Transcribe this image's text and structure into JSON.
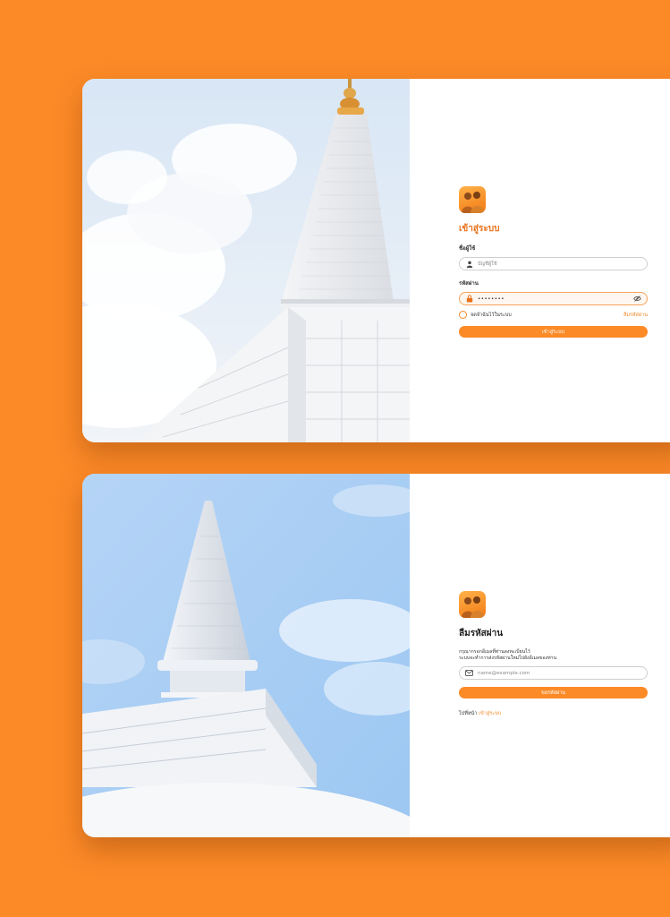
{
  "colors": {
    "background": "#FC8A27",
    "accent": "#FC8A27",
    "link": "#F08A2A"
  },
  "login": {
    "title": "เข้าสู่ระบบ",
    "username_label": "ชื่อผู้ใช้",
    "username_placeholder": "บัญชีผู้ใช้",
    "username_icon": "user-icon",
    "password_label": "รหัสผ่าน",
    "password_value": "••••••••",
    "password_icon": "lock-icon",
    "toggle_icon": "eye-slash-icon",
    "remember_label": "จดจำฉันไว้ในระบบ",
    "forgot_link": "ลืมรหัสผ่าน",
    "submit_label": "เข้าสู่ระบบ"
  },
  "forgot": {
    "title": "ลืมรหัสผ่าน",
    "description_line1": "กรุณากรอกอีเมลที่ท่านลงทะเบียนไว้",
    "description_line2": "ระบบจะทำการส่งรหัสผ่านใหม่ไปยังอีเมลของท่าน",
    "email_placeholder": "name@example.com",
    "email_icon": "mail-icon",
    "submit_label": "ขอรหัสผ่าน",
    "back_prefix": "ไปที่หน้า",
    "back_link": "เข้าสู่ระบบ"
  }
}
